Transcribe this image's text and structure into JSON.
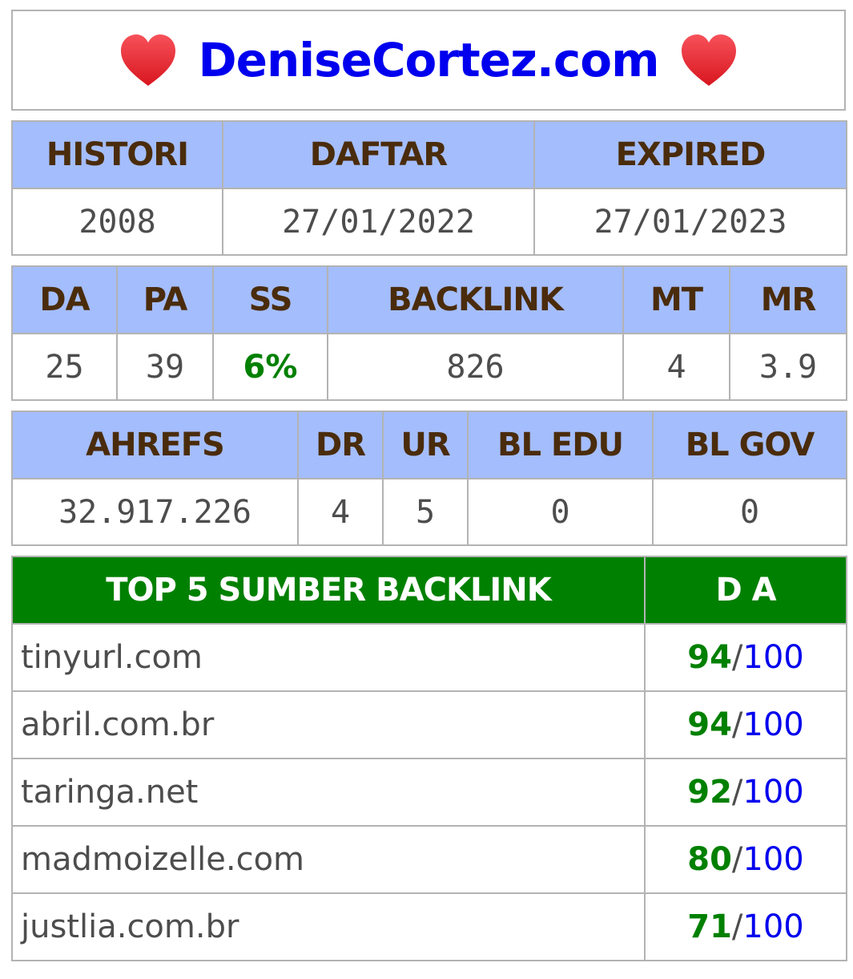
{
  "title": "DeniseCortez.com",
  "colors": {
    "heart": "#e8252e",
    "title": "#0000ee",
    "header_bg": "#a4bdfc",
    "header_text": "#4a2c0c",
    "green": "#008000"
  },
  "domain_info": {
    "headers": [
      "HISTORI",
      "DAFTAR",
      "EXPIRED"
    ],
    "values": [
      "2008",
      "27/01/2022",
      "27/01/2023"
    ]
  },
  "moz": {
    "headers": [
      "DA",
      "PA",
      "SS",
      "BACKLINK",
      "MT",
      "MR"
    ],
    "values": [
      "25",
      "39",
      "6%",
      "826",
      "4",
      "3.9"
    ]
  },
  "ahrefs": {
    "headers": [
      "AHREFS",
      "DR",
      "UR",
      "BL EDU",
      "BL GOV"
    ],
    "values": [
      "32.917.226",
      "4",
      "5",
      "0",
      "0"
    ]
  },
  "top_backlinks": {
    "header_source": "TOP 5 SUMBER BACKLINK",
    "header_da": "D A",
    "slash": "/",
    "max": "100",
    "rows": [
      {
        "source": "tinyurl.com",
        "da": "94"
      },
      {
        "source": "abril.com.br",
        "da": "94"
      },
      {
        "source": "taringa.net",
        "da": "92"
      },
      {
        "source": "madmoizelle.com",
        "da": "80"
      },
      {
        "source": "justlia.com.br",
        "da": "71"
      }
    ]
  }
}
